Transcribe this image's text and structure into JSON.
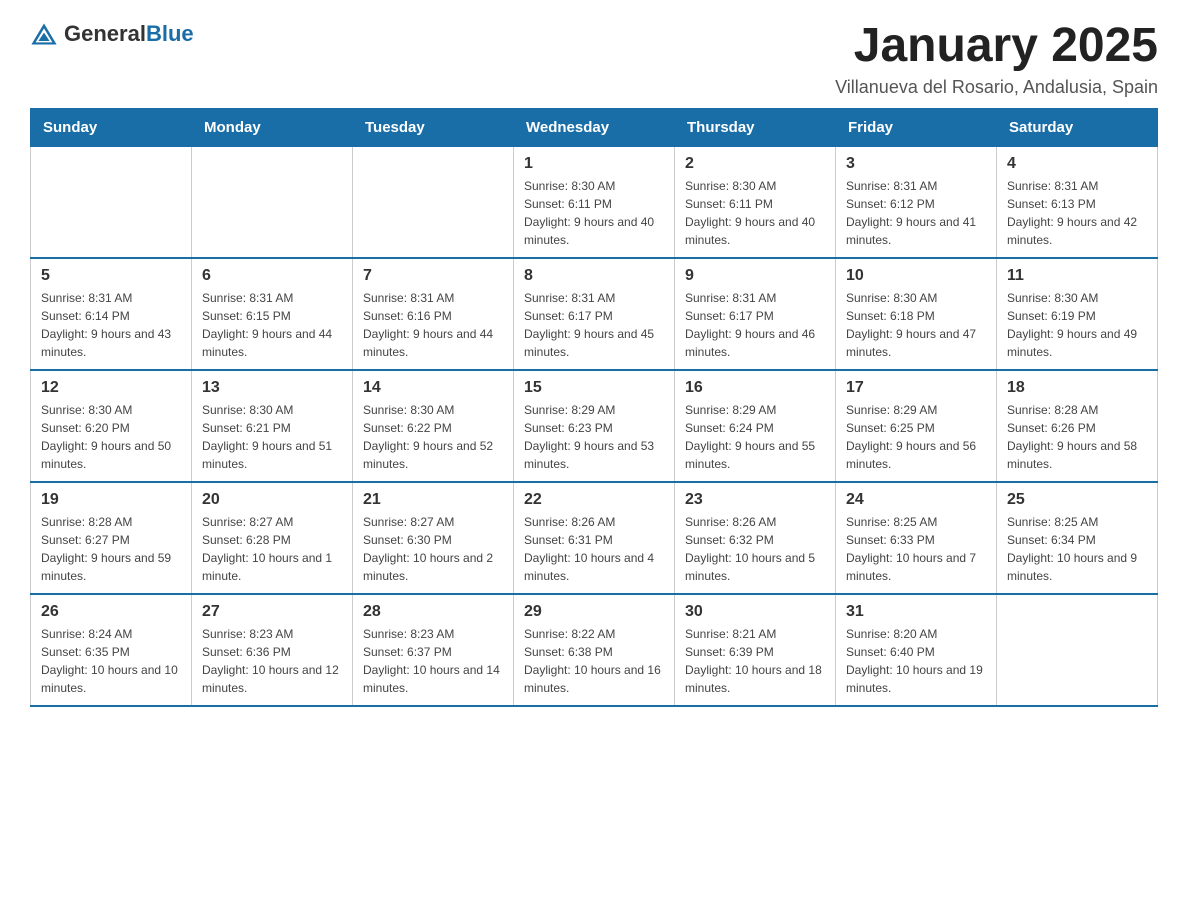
{
  "logo": {
    "general": "General",
    "blue": "Blue"
  },
  "title": "January 2025",
  "location": "Villanueva del Rosario, Andalusia, Spain",
  "days_of_week": [
    "Sunday",
    "Monday",
    "Tuesday",
    "Wednesday",
    "Thursday",
    "Friday",
    "Saturday"
  ],
  "weeks": [
    [
      {
        "day": "",
        "info": ""
      },
      {
        "day": "",
        "info": ""
      },
      {
        "day": "",
        "info": ""
      },
      {
        "day": "1",
        "info": "Sunrise: 8:30 AM\nSunset: 6:11 PM\nDaylight: 9 hours and 40 minutes."
      },
      {
        "day": "2",
        "info": "Sunrise: 8:30 AM\nSunset: 6:11 PM\nDaylight: 9 hours and 40 minutes."
      },
      {
        "day": "3",
        "info": "Sunrise: 8:31 AM\nSunset: 6:12 PM\nDaylight: 9 hours and 41 minutes."
      },
      {
        "day": "4",
        "info": "Sunrise: 8:31 AM\nSunset: 6:13 PM\nDaylight: 9 hours and 42 minutes."
      }
    ],
    [
      {
        "day": "5",
        "info": "Sunrise: 8:31 AM\nSunset: 6:14 PM\nDaylight: 9 hours and 43 minutes."
      },
      {
        "day": "6",
        "info": "Sunrise: 8:31 AM\nSunset: 6:15 PM\nDaylight: 9 hours and 44 minutes."
      },
      {
        "day": "7",
        "info": "Sunrise: 8:31 AM\nSunset: 6:16 PM\nDaylight: 9 hours and 44 minutes."
      },
      {
        "day": "8",
        "info": "Sunrise: 8:31 AM\nSunset: 6:17 PM\nDaylight: 9 hours and 45 minutes."
      },
      {
        "day": "9",
        "info": "Sunrise: 8:31 AM\nSunset: 6:17 PM\nDaylight: 9 hours and 46 minutes."
      },
      {
        "day": "10",
        "info": "Sunrise: 8:30 AM\nSunset: 6:18 PM\nDaylight: 9 hours and 47 minutes."
      },
      {
        "day": "11",
        "info": "Sunrise: 8:30 AM\nSunset: 6:19 PM\nDaylight: 9 hours and 49 minutes."
      }
    ],
    [
      {
        "day": "12",
        "info": "Sunrise: 8:30 AM\nSunset: 6:20 PM\nDaylight: 9 hours and 50 minutes."
      },
      {
        "day": "13",
        "info": "Sunrise: 8:30 AM\nSunset: 6:21 PM\nDaylight: 9 hours and 51 minutes."
      },
      {
        "day": "14",
        "info": "Sunrise: 8:30 AM\nSunset: 6:22 PM\nDaylight: 9 hours and 52 minutes."
      },
      {
        "day": "15",
        "info": "Sunrise: 8:29 AM\nSunset: 6:23 PM\nDaylight: 9 hours and 53 minutes."
      },
      {
        "day": "16",
        "info": "Sunrise: 8:29 AM\nSunset: 6:24 PM\nDaylight: 9 hours and 55 minutes."
      },
      {
        "day": "17",
        "info": "Sunrise: 8:29 AM\nSunset: 6:25 PM\nDaylight: 9 hours and 56 minutes."
      },
      {
        "day": "18",
        "info": "Sunrise: 8:28 AM\nSunset: 6:26 PM\nDaylight: 9 hours and 58 minutes."
      }
    ],
    [
      {
        "day": "19",
        "info": "Sunrise: 8:28 AM\nSunset: 6:27 PM\nDaylight: 9 hours and 59 minutes."
      },
      {
        "day": "20",
        "info": "Sunrise: 8:27 AM\nSunset: 6:28 PM\nDaylight: 10 hours and 1 minute."
      },
      {
        "day": "21",
        "info": "Sunrise: 8:27 AM\nSunset: 6:30 PM\nDaylight: 10 hours and 2 minutes."
      },
      {
        "day": "22",
        "info": "Sunrise: 8:26 AM\nSunset: 6:31 PM\nDaylight: 10 hours and 4 minutes."
      },
      {
        "day": "23",
        "info": "Sunrise: 8:26 AM\nSunset: 6:32 PM\nDaylight: 10 hours and 5 minutes."
      },
      {
        "day": "24",
        "info": "Sunrise: 8:25 AM\nSunset: 6:33 PM\nDaylight: 10 hours and 7 minutes."
      },
      {
        "day": "25",
        "info": "Sunrise: 8:25 AM\nSunset: 6:34 PM\nDaylight: 10 hours and 9 minutes."
      }
    ],
    [
      {
        "day": "26",
        "info": "Sunrise: 8:24 AM\nSunset: 6:35 PM\nDaylight: 10 hours and 10 minutes."
      },
      {
        "day": "27",
        "info": "Sunrise: 8:23 AM\nSunset: 6:36 PM\nDaylight: 10 hours and 12 minutes."
      },
      {
        "day": "28",
        "info": "Sunrise: 8:23 AM\nSunset: 6:37 PM\nDaylight: 10 hours and 14 minutes."
      },
      {
        "day": "29",
        "info": "Sunrise: 8:22 AM\nSunset: 6:38 PM\nDaylight: 10 hours and 16 minutes."
      },
      {
        "day": "30",
        "info": "Sunrise: 8:21 AM\nSunset: 6:39 PM\nDaylight: 10 hours and 18 minutes."
      },
      {
        "day": "31",
        "info": "Sunrise: 8:20 AM\nSunset: 6:40 PM\nDaylight: 10 hours and 19 minutes."
      },
      {
        "day": "",
        "info": ""
      }
    ]
  ]
}
